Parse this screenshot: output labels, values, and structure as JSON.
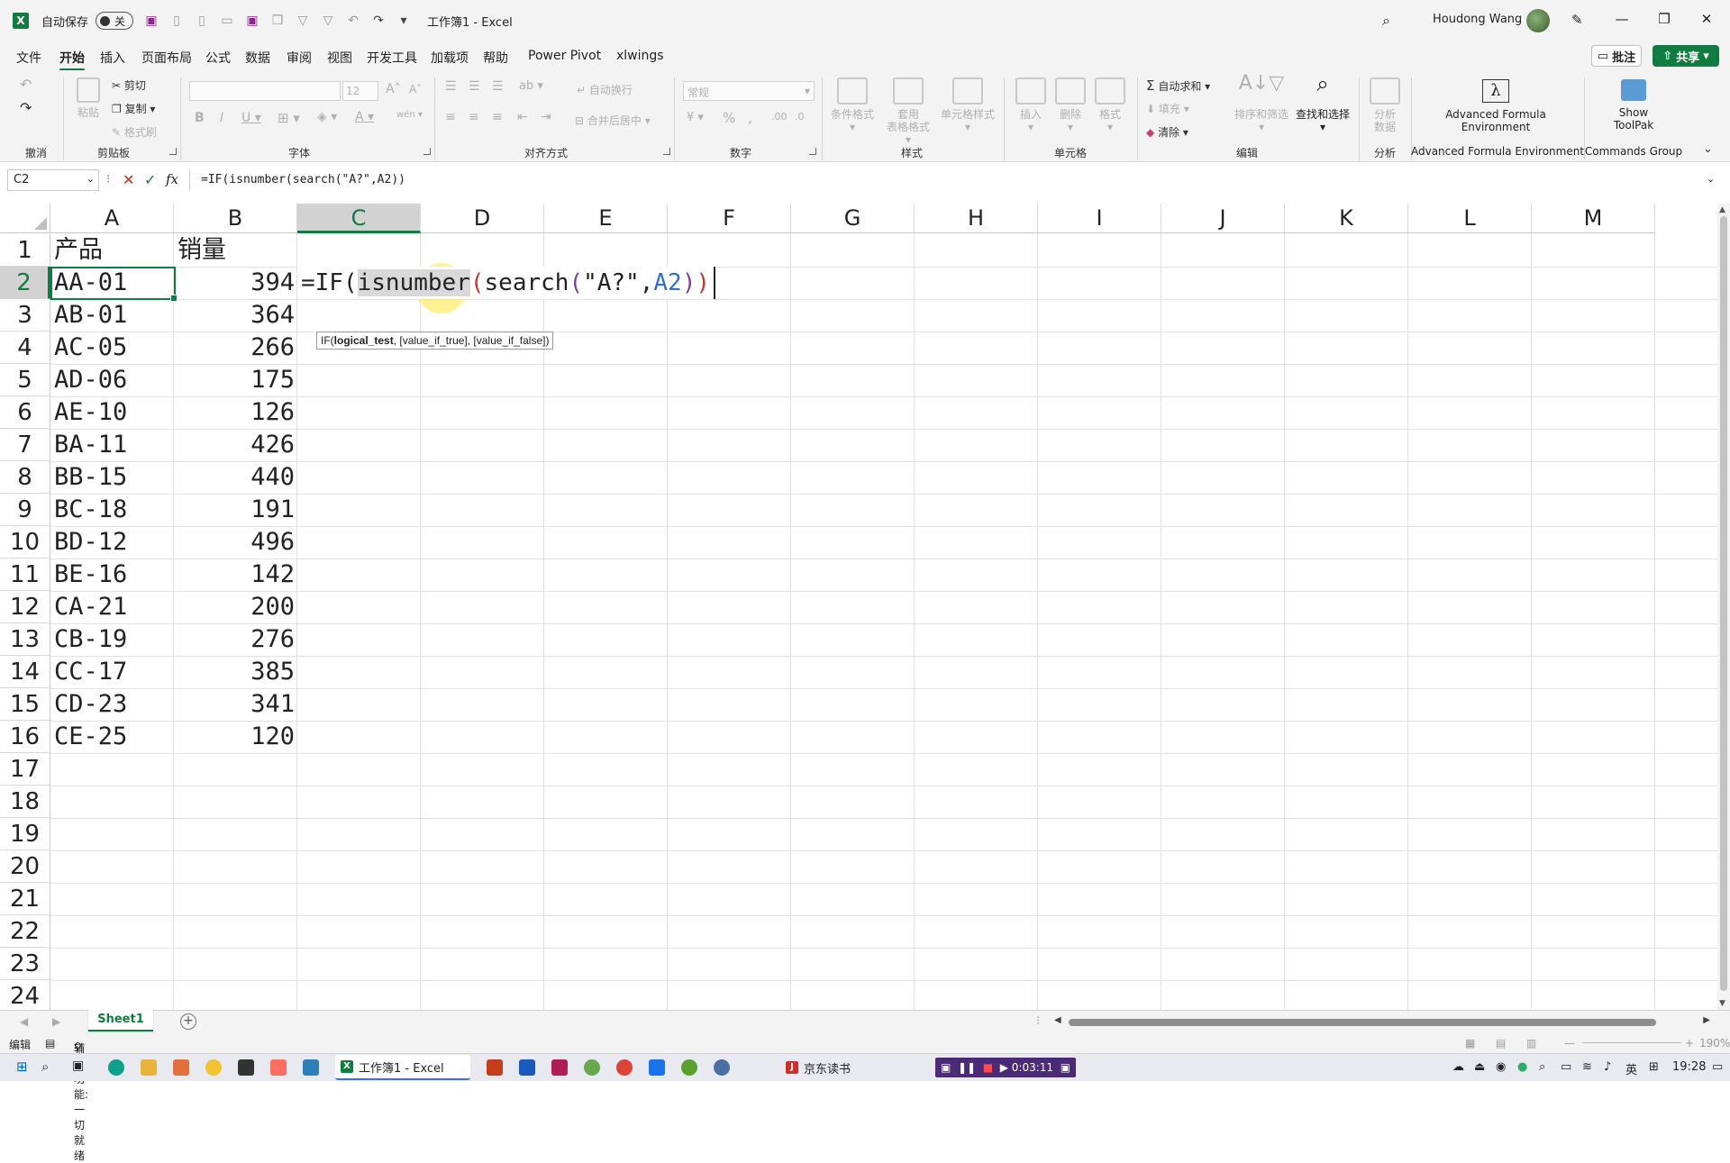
{
  "titlebar": {
    "app_icon": "excel-logo-icon",
    "autosave_label": "自动保存",
    "autosave_state": "关",
    "doc_title": "工作簿1 - Excel",
    "user_name": "Houdong Wang"
  },
  "menu_tabs": [
    "文件",
    "开始",
    "插入",
    "页面布局",
    "公式",
    "数据",
    "审阅",
    "视图",
    "开发工具",
    "加载项",
    "帮助",
    "Power Pivot",
    "xlwings"
  ],
  "active_tab": "开始",
  "menu_actions": {
    "comment": "批注",
    "share": "共享"
  },
  "ribbon": {
    "groups": {
      "undo": "撤消",
      "clipboard": "剪贴板",
      "font": "字体",
      "alignment": "对齐方式",
      "number": "数字",
      "styles": "样式",
      "cells": "单元格",
      "editing": "编辑",
      "analysis": "分析",
      "afe": "Advanced Formula Environment",
      "commands": "Commands Group"
    },
    "clipboard": {
      "paste": "粘贴",
      "cut": "剪切",
      "copy": "复制",
      "format_painter": "格式刷"
    },
    "font": {
      "size": "12"
    },
    "alignment": {
      "wrap": "自动换行",
      "merge": "合并后居中"
    },
    "number": {
      "format": "常规"
    },
    "styles": {
      "conditional": "条件格式",
      "table_1": "套用",
      "table_2": "表格格式",
      "cell_styles": "单元格样式"
    },
    "cells": {
      "insert": "插入",
      "delete": "删除",
      "format": "格式"
    },
    "editing": {
      "autosum": "自动求和",
      "fill": "填充",
      "clear": "清除",
      "sort_filter": "排序和筛选",
      "find_select": "查找和选择"
    },
    "analysis": {
      "analyze_1": "分析",
      "analyze_2": "数据"
    },
    "afe": {
      "line1": "Advanced Formula",
      "line2": "Environment"
    },
    "toolpak": {
      "line1": "Show",
      "line2": "ToolPak"
    }
  },
  "formula_bar": {
    "name_box": "C2",
    "cancel_glyph": "✕",
    "enter_glyph": "✓",
    "fx": "fx",
    "formula": "=IF(isnumber(search(\"A?\",A2))"
  },
  "columns": [
    "A",
    "B",
    "C",
    "D",
    "E",
    "F",
    "G",
    "H",
    "I",
    "J",
    "K",
    "L",
    "M"
  ],
  "selected_column": "C",
  "rows": [
    "1",
    "2",
    "3",
    "4",
    "5",
    "6",
    "7",
    "8",
    "9",
    "10",
    "11",
    "12",
    "13",
    "14",
    "15",
    "16",
    "17",
    "18",
    "19",
    "20",
    "21",
    "22",
    "23",
    "24"
  ],
  "selected_row": "2",
  "sheet": {
    "header": {
      "a": "产品",
      "b": "销量"
    },
    "data": [
      {
        "product": "AA-01",
        "sales": "394"
      },
      {
        "product": "AB-01",
        "sales": "364"
      },
      {
        "product": "AC-05",
        "sales": "266"
      },
      {
        "product": "AD-06",
        "sales": "175"
      },
      {
        "product": "AE-10",
        "sales": "126"
      },
      {
        "product": "BA-11",
        "sales": "426"
      },
      {
        "product": "BB-15",
        "sales": "440"
      },
      {
        "product": "BC-18",
        "sales": "191"
      },
      {
        "product": "BD-12",
        "sales": "496"
      },
      {
        "product": "BE-16",
        "sales": "142"
      },
      {
        "product": "CA-21",
        "sales": "200"
      },
      {
        "product": "CB-19",
        "sales": "276"
      },
      {
        "product": "CC-17",
        "sales": "385"
      },
      {
        "product": "CD-23",
        "sales": "341"
      },
      {
        "product": "CE-25",
        "sales": "120"
      }
    ]
  },
  "edit_cell": {
    "eq": "=IF(",
    "isnumber": "isnumber",
    "open1": "(",
    "search": "search",
    "open2": "(",
    "str": "\"A?\",",
    "ref": "A2",
    "close2": ")",
    "close1": ")"
  },
  "tooltip": {
    "fn": "IF(",
    "arg1": "logical_test",
    "rest": ", [value_if_true], [value_if_false])"
  },
  "sheet_tabs": [
    "Sheet1"
  ],
  "status": {
    "mode": "编辑",
    "accessibility": "辅助功能: 一切就绪",
    "zoom": "190%"
  },
  "taskbar": {
    "excel_item": "工作簿1 - Excel",
    "jd_item": "京东读书",
    "rec_time": "0:03:11",
    "ime": "英",
    "clock": "19:28"
  },
  "colors": {
    "excel_green": "#107c41",
    "formula_red": "#c0392b",
    "formula_purple": "#7b3fa0",
    "formula_blue": "#2e6fd3"
  }
}
